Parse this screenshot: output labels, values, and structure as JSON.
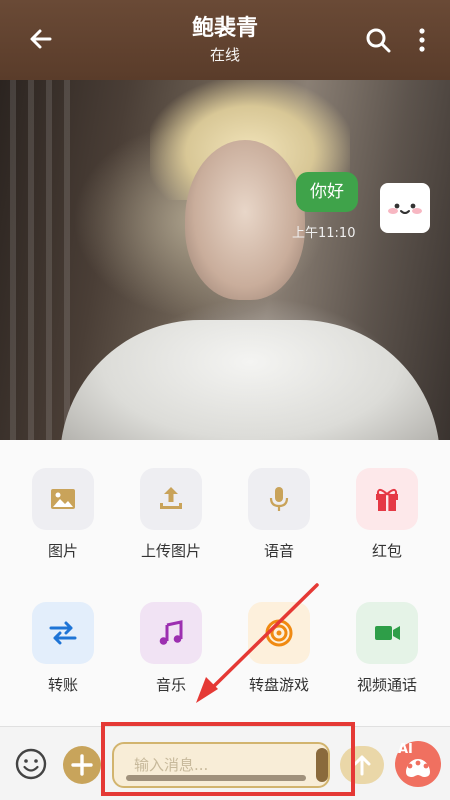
{
  "header": {
    "title": "鲍裴青",
    "subtitle": "在线",
    "background_color": "#5e4130"
  },
  "chat": {
    "messages": [
      {
        "text": "你好",
        "time": "上午11:10",
        "sender": "self",
        "bubble_color": "#3fa34a"
      }
    ]
  },
  "tools": [
    {
      "label": "图片",
      "icon": "image-icon",
      "bg": "#eeeef2",
      "color": "#c9a35a"
    },
    {
      "label": "上传图片",
      "icon": "upload-icon",
      "bg": "#eeeef2",
      "color": "#c9a35a"
    },
    {
      "label": "语音",
      "icon": "microphone-icon",
      "bg": "#eeeef2",
      "color": "#c9a35a"
    },
    {
      "label": "红包",
      "icon": "gift-icon",
      "bg": "#fde8ea",
      "color": "#e53945"
    },
    {
      "label": "转账",
      "icon": "transfer-icon",
      "bg": "#e3eefb",
      "color": "#1e74d6"
    },
    {
      "label": "音乐",
      "icon": "music-icon",
      "bg": "#f1e3f4",
      "color": "#9c2fb0"
    },
    {
      "label": "转盘游戏",
      "icon": "wheel-icon",
      "bg": "#fdf0dc",
      "color": "#f08a12"
    },
    {
      "label": "视频通话",
      "icon": "video-icon",
      "bg": "#e5f3e7",
      "color": "#2e9e48"
    }
  ],
  "input_bar": {
    "placeholder": "输入消息...",
    "ai_label": "AI",
    "accent_color": "#c8a45b"
  },
  "annotation": {
    "box_color": "#e53935"
  }
}
